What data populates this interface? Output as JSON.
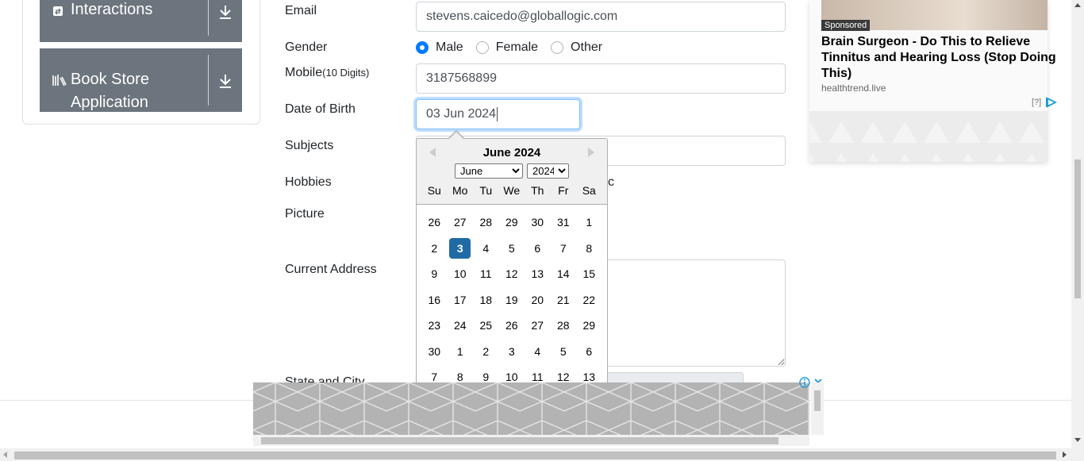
{
  "sidebar": {
    "groups": [
      {
        "label": "Interactions",
        "icon": "interactions-icon"
      },
      {
        "label": "Book Store Application",
        "label_line1": "Book Store",
        "label_line2": "Application",
        "icon": "book-store-icon"
      }
    ]
  },
  "form": {
    "email": {
      "label": "Email",
      "value": "stevens.caicedo@globallogic.com"
    },
    "gender": {
      "label": "Gender",
      "options": [
        "Male",
        "Female",
        "Other"
      ],
      "selected": "Male"
    },
    "mobile": {
      "label": "Mobile",
      "hint": "(10 Digits)",
      "value": "3187568899"
    },
    "dob": {
      "label": "Date of Birth",
      "value": "03 Jun 2024"
    },
    "subjects": {
      "label": "Subjects"
    },
    "hobbies": {
      "label": "Hobbies",
      "visible_fragment": "c"
    },
    "picture": {
      "label": "Picture"
    },
    "current_address": {
      "label": "Current Address"
    },
    "state_city": {
      "label": "State and City"
    }
  },
  "datepicker": {
    "title": "June 2024",
    "month_selected": "June",
    "year_selected": "2024",
    "weekdays": [
      "Su",
      "Mo",
      "Tu",
      "We",
      "Th",
      "Fr",
      "Sa"
    ],
    "weeks": [
      [
        "26",
        "27",
        "28",
        "29",
        "30",
        "31",
        "1"
      ],
      [
        "2",
        "3",
        "4",
        "5",
        "6",
        "7",
        "8"
      ],
      [
        "9",
        "10",
        "11",
        "12",
        "13",
        "14",
        "15"
      ],
      [
        "16",
        "17",
        "18",
        "19",
        "20",
        "21",
        "22"
      ],
      [
        "23",
        "24",
        "25",
        "26",
        "27",
        "28",
        "29"
      ],
      [
        "30",
        "1",
        "2",
        "3",
        "4",
        "5",
        "6"
      ],
      [
        "7",
        "8",
        "9",
        "10",
        "11",
        "12",
        "13"
      ]
    ],
    "selected_day": "3"
  },
  "side_ad": {
    "badge": "Sponsored",
    "headline": "Brain Surgeon - Do This to Relieve Tinnitus and Hearing Loss (Stop Doing This)",
    "source": "healthtrend.live",
    "help": "[?]"
  },
  "colors": {
    "sidebar_group": "#6c757d",
    "selected_day": "#216ba5",
    "radio_checked": "#007bff",
    "focus_border": "#80bdff"
  }
}
